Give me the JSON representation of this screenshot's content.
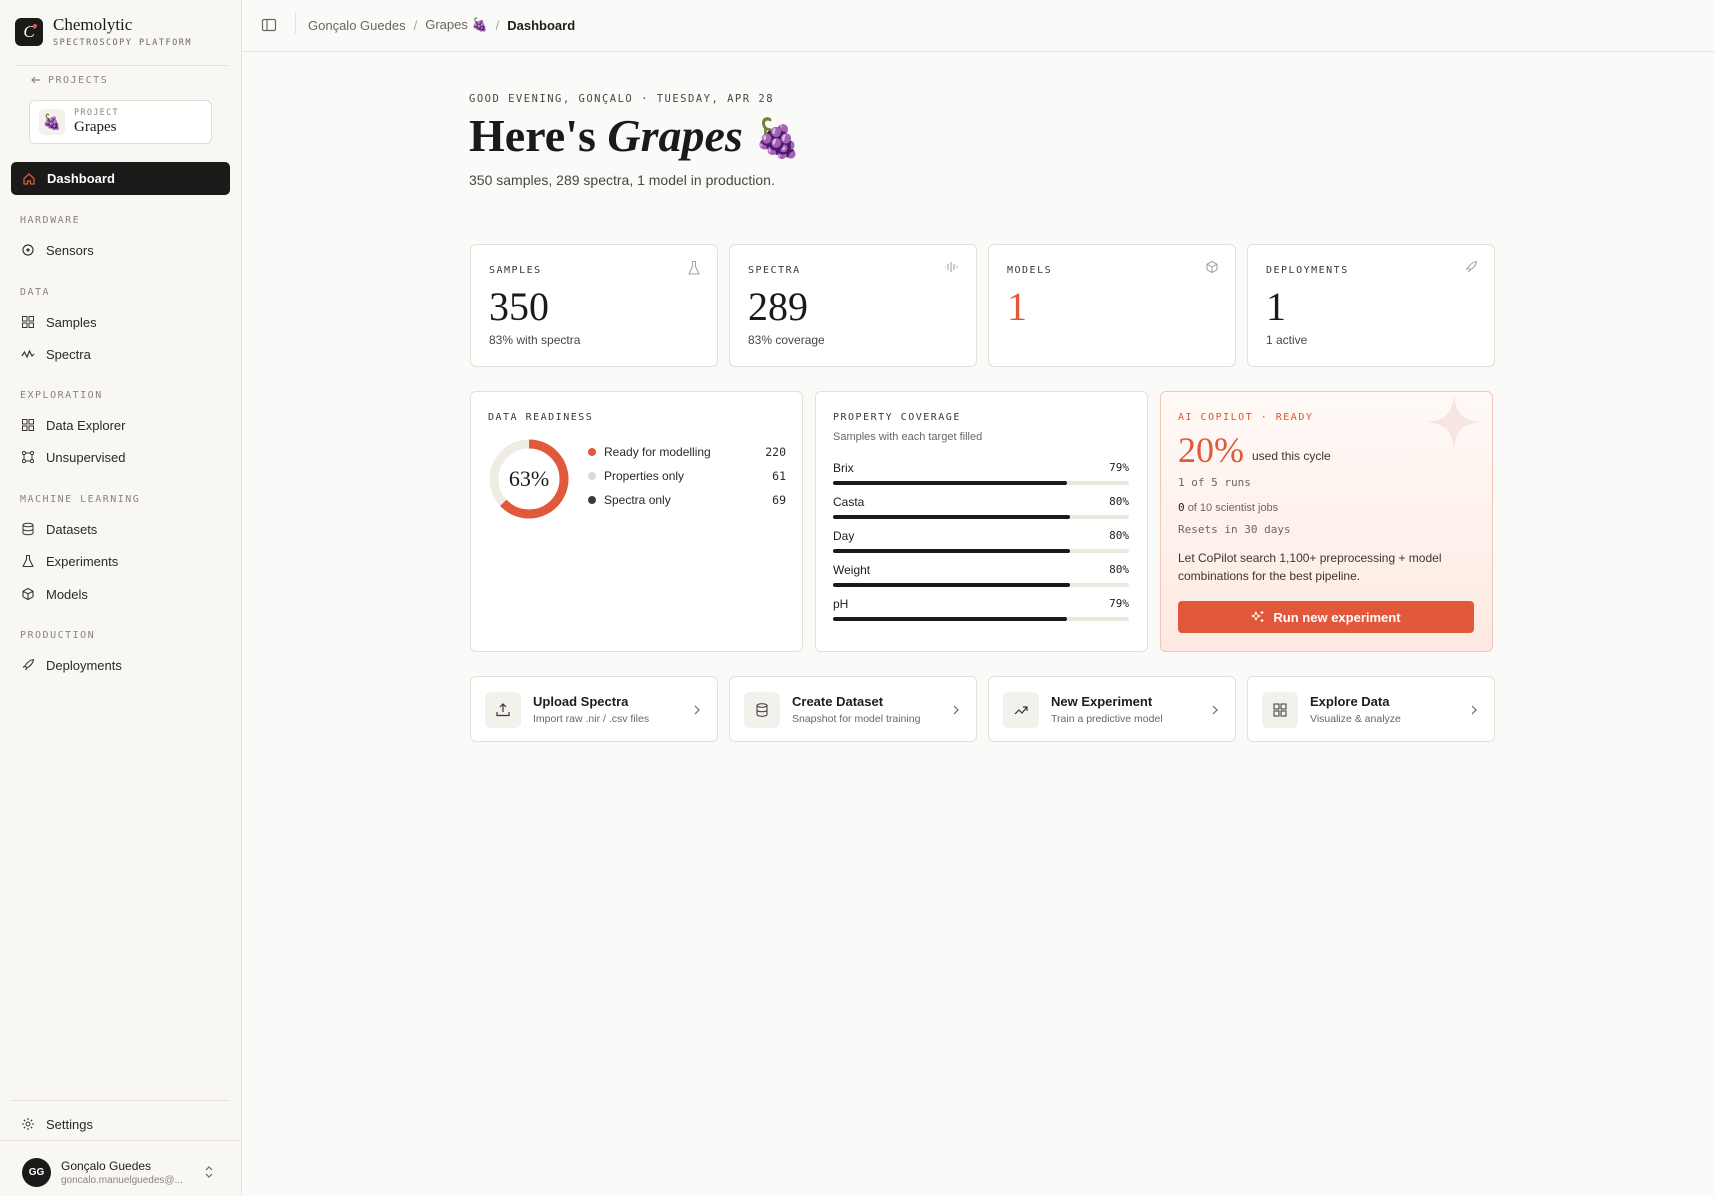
{
  "brand": {
    "name": "Chemolytic",
    "subtitle": "SPECTROSCOPY PLATFORM",
    "logo_letter": "C"
  },
  "sidebar": {
    "back_label": "PROJECTS",
    "project": {
      "label": "PROJECT",
      "name": "Grapes",
      "emoji": "🍇"
    },
    "active_item": "Dashboard",
    "sections": {
      "hardware": "HARDWARE",
      "data": "DATA",
      "exploration": "EXPLORATION",
      "ml": "MACHINE LEARNING",
      "production": "PRODUCTION"
    },
    "items": {
      "sensors": "Sensors",
      "samples": "Samples",
      "spectra": "Spectra",
      "data_explorer": "Data Explorer",
      "unsupervised": "Unsupervised",
      "datasets": "Datasets",
      "experiments": "Experiments",
      "models": "Models",
      "deployments": "Deployments"
    },
    "settings": "Settings",
    "user": {
      "initials": "GG",
      "name": "Gonçalo Guedes",
      "email": "goncalo.manuelguedes@..."
    }
  },
  "breadcrumb": {
    "user": "Gonçalo Guedes",
    "project": "Grapes 🍇",
    "current": "Dashboard"
  },
  "header": {
    "greeting": "GOOD EVENING, GONÇALO · TUESDAY, APR 28",
    "title_prefix": "Here's",
    "title_project": "Grapes",
    "title_emoji": "🍇",
    "summary": "350 samples, 289 spectra, 1 model in production."
  },
  "stats": [
    {
      "label": "SAMPLES",
      "value": "350",
      "foot": "83% with spectra",
      "icon": "flask-icon"
    },
    {
      "label": "SPECTRA",
      "value": "289",
      "foot": "83% coverage",
      "icon": "waveform-icon"
    },
    {
      "label": "MODELS",
      "value": "1",
      "foot": "",
      "icon": "cube-icon"
    },
    {
      "label": "DEPLOYMENTS",
      "value": "1",
      "foot": "1 active",
      "icon": "rocket-icon"
    }
  ],
  "readiness": {
    "title": "DATA READINESS",
    "percent_label": "63%",
    "percent": 0.63,
    "legend": [
      {
        "label": "Ready for modelling",
        "value": "220",
        "color": "#e2583a"
      },
      {
        "label": "Properties only",
        "value": "61",
        "color": "#dcd8cc"
      },
      {
        "label": "Spectra only",
        "value": "69",
        "color": "#3d3a35"
      }
    ]
  },
  "coverage": {
    "title": "PROPERTY COVERAGE",
    "subtitle": "Samples with each target filled",
    "rows": [
      {
        "name": "Brix",
        "pct_label": "79%",
        "pct": 79
      },
      {
        "name": "Casta",
        "pct_label": "80%",
        "pct": 80
      },
      {
        "name": "Day",
        "pct_label": "80%",
        "pct": 80
      },
      {
        "name": "Weight",
        "pct_label": "80%",
        "pct": 80
      },
      {
        "name": "pH",
        "pct_label": "79%",
        "pct": 79
      }
    ]
  },
  "copilot": {
    "title": "AI COPILOT · READY",
    "usage": "20%",
    "usage_note": "used this cycle",
    "runs": "1 of 5 runs",
    "jobs_count": "0",
    "jobs_note": "of 10 scientist jobs",
    "resets": "Resets in 30 days",
    "description": "Let CoPilot search 1,100+ preprocessing + model combinations for the best pipeline.",
    "button": "Run new experiment",
    "accent": "#e2583a"
  },
  "actions": [
    {
      "title": "Upload Spectra",
      "subtitle": "Import raw .nir / .csv files",
      "icon": "upload-icon"
    },
    {
      "title": "Create Dataset",
      "subtitle": "Snapshot for model training",
      "icon": "database-icon"
    },
    {
      "title": "New Experiment",
      "subtitle": "Train a predictive model",
      "icon": "trend-icon"
    },
    {
      "title": "Explore Data",
      "subtitle": "Visualize & analyze",
      "icon": "grid-icon"
    }
  ]
}
